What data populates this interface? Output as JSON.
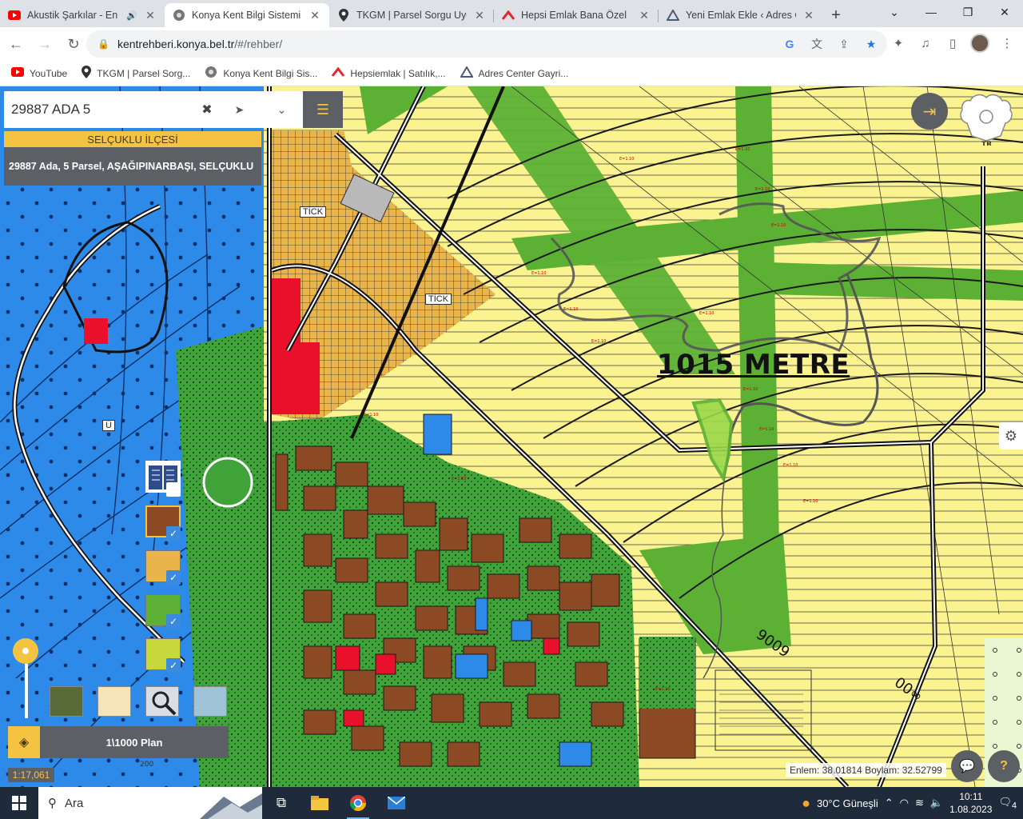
{
  "browser": {
    "tabs": [
      {
        "title": "Akustik Şarkılar - En Ç",
        "icon": "youtube-icon",
        "active": false
      },
      {
        "title": "Konya Kent Bilgi Sistemi",
        "icon": "kent-icon",
        "active": true
      },
      {
        "title": "TKGM | Parsel Sorgu Uyg",
        "icon": "location-pin-icon",
        "active": false
      },
      {
        "title": "Hepsi Emlak Bana Özel",
        "icon": "hepsiemlak-icon",
        "active": false
      },
      {
        "title": "Yeni Emlak Ekle ‹ Adres Ce",
        "icon": "adres-center-icon",
        "active": false
      }
    ],
    "url_host": "kentrehberi.konya.bel.tr",
    "url_path": "/#/rehber/",
    "bookmarks": [
      {
        "label": "YouTube",
        "icon": "youtube-icon"
      },
      {
        "label": "TKGM | Parsel Sorg...",
        "icon": "location-pin-icon"
      },
      {
        "label": "Konya Kent Bilgi Sis...",
        "icon": "kent-icon"
      },
      {
        "label": "Hepsiemlak | Satılık,...",
        "icon": "hepsiemlak-icon"
      },
      {
        "label": "Adres Center Gayri...",
        "icon": "adres-center-icon"
      }
    ]
  },
  "app": {
    "search_value": "29887 ADA 5",
    "district": "SELÇUKLU İLÇESİ",
    "parcel_result": "29887 Ada, 5 Parsel, AŞAĞIPINARBAŞI, SELÇUKLU",
    "distance_label": "1015 METRE",
    "map_labels": [
      "TİCK",
      "TİCK",
      "Ü"
    ],
    "logo_text": "TR",
    "plan_name": "1\\1000 Plan",
    "scale": "1:17,061",
    "coords": "Enlem: 38.01814 Boylam: 32.52799",
    "colors": {
      "accent": "#f5c342",
      "panel": "#5c6064",
      "map_residential_yellow": "#fbf38f",
      "map_green": "#5cb135",
      "map_water_blue": "#2d8ae8",
      "map_red": "#e8102a",
      "map_brown": "#8b4a23"
    }
  },
  "taskbar": {
    "search_placeholder": "Ara",
    "weather": "30°C  Güneşli",
    "time": "10:11",
    "date": "1.08.2023",
    "notifications": "4"
  }
}
